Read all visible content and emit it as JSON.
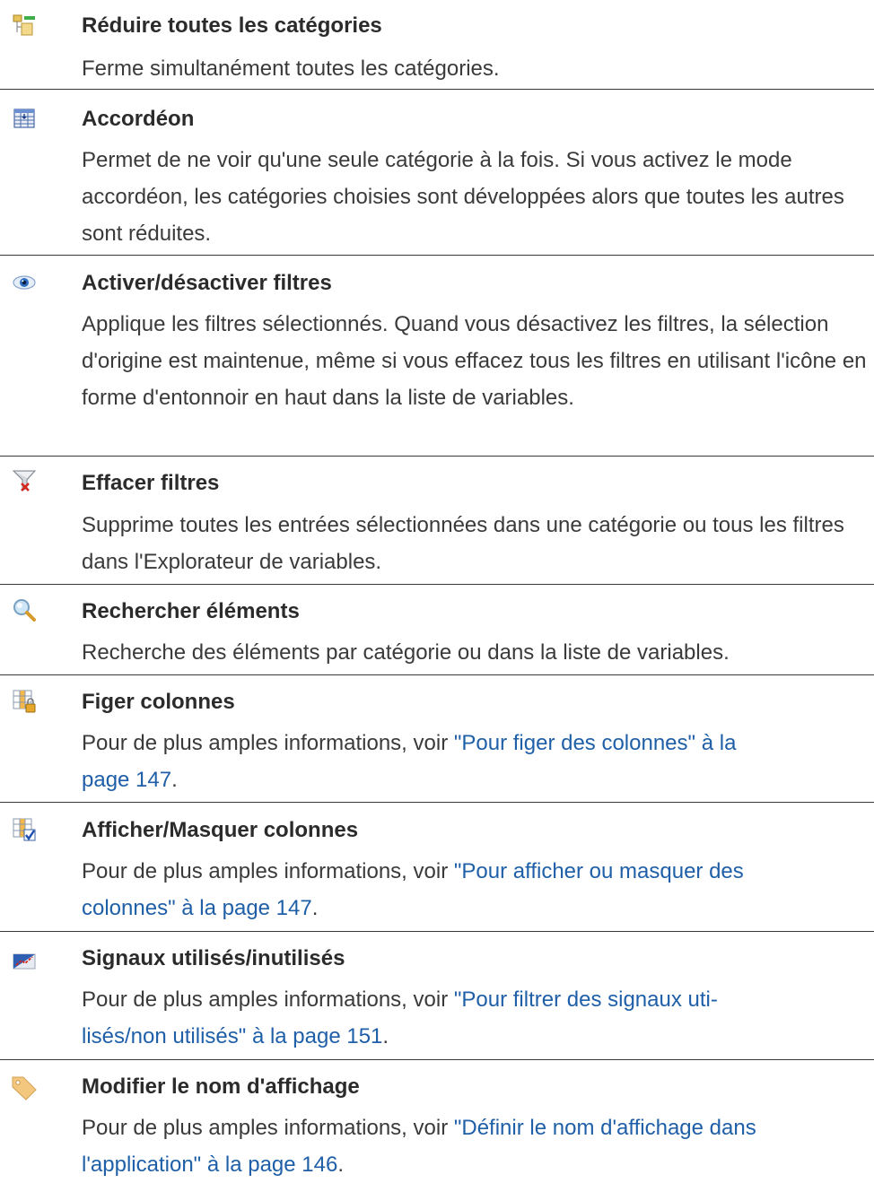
{
  "entries": [
    {
      "icon": "collapse-categories-icon",
      "title": "Réduire toutes les catégories",
      "desc": "Ferme simultanément toutes les catégories."
    },
    {
      "icon": "accordion-icon",
      "title": "Accordéon",
      "desc": "Permet de ne voir qu'une seule catégorie à la fois. Si vous activez le mode accordéon, les catégories choisies sont développées alors que toutes les autres sont réduites."
    },
    {
      "icon": "eye-icon",
      "title": "Activer/désactiver filtres",
      "desc": "Applique les filtres sélectionnés. Quand vous désactivez les filtres, la sélection d'origine est maintenue, même si vous effacez tous les filtres en utilisant l'icône en forme d'entonnoir en haut dans la liste de variables."
    },
    {
      "icon": "clear-filter-funnel-icon",
      "title": "Effacer filtres",
      "desc": "Supprime toutes les entrées sélectionnées dans une catégorie ou tous les filtres dans l'Explorateur de variables."
    },
    {
      "icon": "magnifier-icon",
      "title": "Rechercher éléments",
      "desc": "Recherche des éléments par catégorie ou dans la liste de variables."
    },
    {
      "icon": "freeze-columns-icon",
      "title": "Figer colonnes",
      "desc_prefix": "Pour de plus amples informations, voir ",
      "link_line1": "\"Pour figer des colonnes\" à la",
      "link_line2": "page 147",
      "desc_suffix": "."
    },
    {
      "icon": "show-hide-columns-icon",
      "title": "Afficher/Masquer colonnes",
      "desc_prefix": "Pour de plus amples informations, voir ",
      "link_line1": "\"Pour afficher ou masquer des",
      "link_line2": "colonnes\" à la page 147",
      "desc_suffix": "."
    },
    {
      "icon": "used-unused-signals-icon",
      "title": "Signaux utilisés/inutilisés",
      "desc_prefix": "Pour de plus amples informations, voir ",
      "link_line1": "\"Pour filtrer des signaux uti-",
      "link_line2": "lisés/non utilisés\" à la page 151",
      "desc_suffix": "."
    },
    {
      "icon": "tag-icon",
      "title": "Modifier le nom d'affichage",
      "desc_prefix": "Pour de plus amples informations, voir ",
      "link_line1": "\"Définir le nom d'affichage dans",
      "link_line2": "l'application\" à la page 146",
      "desc_suffix": "."
    }
  ]
}
